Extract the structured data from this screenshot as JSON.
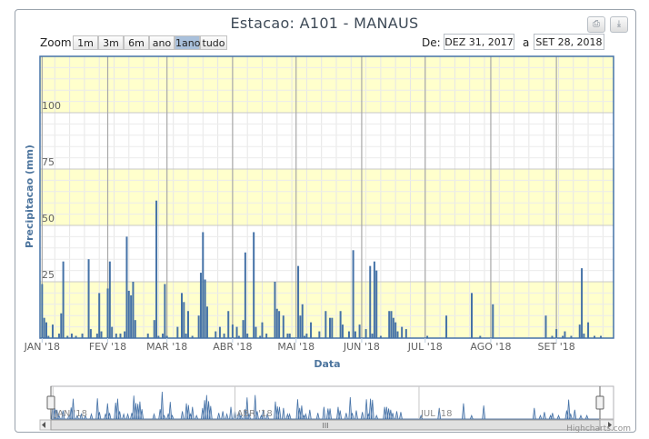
{
  "title": "Estacao: A101 - MANAUS",
  "toolbar": {
    "zoom_label": "Zoom",
    "zoom_buttons": [
      {
        "label": "1m",
        "active": false
      },
      {
        "label": "3m",
        "active": false
      },
      {
        "label": "6m",
        "active": false
      },
      {
        "label": "ano",
        "active": false
      },
      {
        "label": "1ano",
        "active": true
      },
      {
        "label": "tudo",
        "active": false
      }
    ],
    "from_label": "De:",
    "from_value": "DEZ 31, 2017",
    "to_label": "a",
    "to_value": "SET 28, 2018",
    "print_icon": "printer-icon",
    "download_icon": "download-icon"
  },
  "credits": "Highcharts.com",
  "navigator": {
    "labels": [
      "JAN '18",
      "ABR '18",
      "JUL '18"
    ],
    "scroll_grip": "III"
  },
  "colors": {
    "series": "#4572a7",
    "band": "#ffffcc",
    "axis_title": "#4d759e",
    "navigator_fill": "#bfcde0"
  },
  "chart_data": {
    "type": "bar",
    "title": "Estacao: A101 - MANAUS",
    "xlabel": "Data",
    "ylabel": "Precipitacao (mm)",
    "xlim": [
      "2017-12-31",
      "2018-09-28"
    ],
    "ylim": [
      0,
      125
    ],
    "yticks": [
      25,
      50,
      75,
      100
    ],
    "xticks": [
      "JAN '18",
      "FEV '18",
      "MAR '18",
      "ABR '18",
      "MAI '18",
      "JUN '18",
      "JUL '18",
      "AGO '18",
      "SET '18"
    ],
    "grid": true,
    "series": [
      {
        "values": [
          [
            "2018-01-01",
            24
          ],
          [
            "2018-01-02",
            9
          ],
          [
            "2018-01-03",
            7
          ],
          [
            "2018-01-04",
            1
          ],
          [
            "2018-01-06",
            6
          ],
          [
            "2018-01-09",
            2
          ],
          [
            "2018-01-10",
            11
          ],
          [
            "2018-01-11",
            34
          ],
          [
            "2018-01-13",
            1
          ],
          [
            "2018-01-15",
            2
          ],
          [
            "2018-01-17",
            1
          ],
          [
            "2018-01-20",
            2
          ],
          [
            "2018-01-23",
            35
          ],
          [
            "2018-01-24",
            4
          ],
          [
            "2018-01-27",
            2
          ],
          [
            "2018-01-28",
            20
          ],
          [
            "2018-01-29",
            3
          ],
          [
            "2018-02-01",
            22
          ],
          [
            "2018-02-02",
            34
          ],
          [
            "2018-02-03",
            5
          ],
          [
            "2018-02-05",
            2
          ],
          [
            "2018-02-07",
            2
          ],
          [
            "2018-02-09",
            3
          ],
          [
            "2018-02-10",
            45
          ],
          [
            "2018-02-11",
            21
          ],
          [
            "2018-02-12",
            19
          ],
          [
            "2018-02-13",
            25
          ],
          [
            "2018-02-14",
            8
          ],
          [
            "2018-02-20",
            2
          ],
          [
            "2018-02-23",
            8
          ],
          [
            "2018-02-24",
            61
          ],
          [
            "2018-02-25",
            1
          ],
          [
            "2018-02-27",
            2
          ],
          [
            "2018-02-28",
            24
          ],
          [
            "2018-03-01",
            1
          ],
          [
            "2018-03-06",
            5
          ],
          [
            "2018-03-08",
            20
          ],
          [
            "2018-03-09",
            16
          ],
          [
            "2018-03-10",
            2
          ],
          [
            "2018-03-11",
            12
          ],
          [
            "2018-03-13",
            1
          ],
          [
            "2018-03-16",
            10
          ],
          [
            "2018-03-17",
            29
          ],
          [
            "2018-03-18",
            47
          ],
          [
            "2018-03-19",
            26
          ],
          [
            "2018-03-20",
            14
          ],
          [
            "2018-03-24",
            3
          ],
          [
            "2018-03-26",
            5
          ],
          [
            "2018-03-28",
            2
          ],
          [
            "2018-03-30",
            12
          ],
          [
            "2018-04-01",
            6
          ],
          [
            "2018-04-03",
            5
          ],
          [
            "2018-04-04",
            1
          ],
          [
            "2018-04-06",
            8
          ],
          [
            "2018-04-07",
            38
          ],
          [
            "2018-04-08",
            2
          ],
          [
            "2018-04-11",
            47
          ],
          [
            "2018-04-12",
            5
          ],
          [
            "2018-04-14",
            1
          ],
          [
            "2018-04-15",
            7
          ],
          [
            "2018-04-17",
            2
          ],
          [
            "2018-04-21",
            25
          ],
          [
            "2018-04-22",
            13
          ],
          [
            "2018-04-23",
            12
          ],
          [
            "2018-04-25",
            10
          ],
          [
            "2018-04-27",
            2
          ],
          [
            "2018-04-28",
            2
          ],
          [
            "2018-05-02",
            32
          ],
          [
            "2018-05-03",
            10
          ],
          [
            "2018-05-04",
            15
          ],
          [
            "2018-05-05",
            1
          ],
          [
            "2018-05-06",
            2
          ],
          [
            "2018-05-08",
            7
          ],
          [
            "2018-05-12",
            3
          ],
          [
            "2018-05-15",
            12
          ],
          [
            "2018-05-17",
            9
          ],
          [
            "2018-05-18",
            9
          ],
          [
            "2018-05-22",
            12
          ],
          [
            "2018-05-23",
            6
          ],
          [
            "2018-05-26",
            3
          ],
          [
            "2018-05-28",
            39
          ],
          [
            "2018-05-29",
            3
          ],
          [
            "2018-05-31",
            6
          ],
          [
            "2018-06-03",
            4
          ],
          [
            "2018-06-05",
            32
          ],
          [
            "2018-06-06",
            2
          ],
          [
            "2018-06-07",
            34
          ],
          [
            "2018-06-08",
            30
          ],
          [
            "2018-06-10",
            1
          ],
          [
            "2018-06-14",
            12
          ],
          [
            "2018-06-15",
            12
          ],
          [
            "2018-06-16",
            9
          ],
          [
            "2018-06-17",
            7
          ],
          [
            "2018-06-18",
            3
          ],
          [
            "2018-06-20",
            5
          ],
          [
            "2018-06-22",
            4
          ],
          [
            "2018-07-02",
            1
          ],
          [
            "2018-07-11",
            10
          ],
          [
            "2018-07-23",
            20
          ],
          [
            "2018-07-27",
            1
          ],
          [
            "2018-08-02",
            15
          ],
          [
            "2018-08-27",
            10
          ],
          [
            "2018-08-30",
            1
          ],
          [
            "2018-09-01",
            4
          ],
          [
            "2018-09-04",
            1
          ],
          [
            "2018-09-05",
            3
          ],
          [
            "2018-09-08",
            1
          ],
          [
            "2018-09-12",
            6
          ],
          [
            "2018-09-13",
            31
          ],
          [
            "2018-09-14",
            2
          ],
          [
            "2018-09-16",
            7
          ],
          [
            "2018-09-19",
            1
          ],
          [
            "2018-09-22",
            1
          ]
        ]
      }
    ]
  }
}
